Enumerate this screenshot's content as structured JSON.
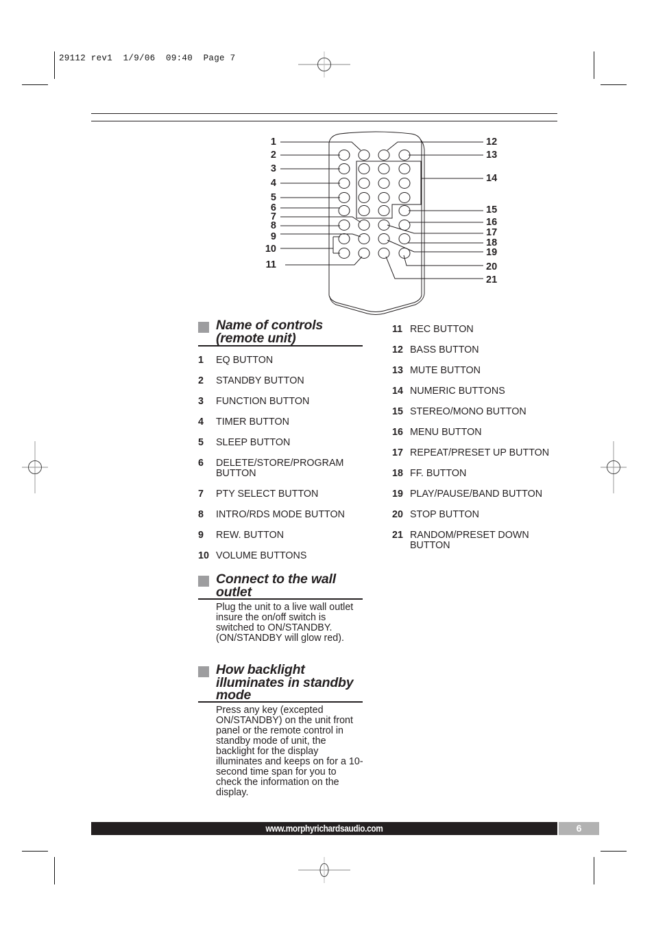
{
  "slug_line": "29112 rev1  1/9/06  09:40  Page 7",
  "diagram": {
    "left_callouts": [
      "1",
      "2",
      "3",
      "4",
      "5",
      "6",
      "7",
      "8",
      "9",
      "10",
      "11"
    ],
    "right_callouts": [
      "12",
      "13",
      "14",
      "15",
      "16",
      "17",
      "18",
      "19",
      "20",
      "21"
    ]
  },
  "sections": {
    "controls": {
      "title": "Name of controls (remote unit)",
      "items": [
        {
          "num": "1",
          "label": "EQ BUTTON"
        },
        {
          "num": "2",
          "label": "STANDBY BUTTON"
        },
        {
          "num": "3",
          "label": "FUNCTION BUTTON"
        },
        {
          "num": "4",
          "label": "TIMER BUTTON"
        },
        {
          "num": "5",
          "label": "SLEEP BUTTON"
        },
        {
          "num": "6",
          "label": "DELETE/STORE/PROGRAM BUTTON"
        },
        {
          "num": "7",
          "label": "PTY SELECT BUTTON"
        },
        {
          "num": "8",
          "label": "INTRO/RDS MODE BUTTON"
        },
        {
          "num": "9",
          "label": "REW. BUTTON"
        },
        {
          "num": "10",
          "label": "VOLUME BUTTONS"
        },
        {
          "num": "11",
          "label": "REC BUTTON"
        },
        {
          "num": "12",
          "label": "BASS BUTTON"
        },
        {
          "num": "13",
          "label": "MUTE BUTTON"
        },
        {
          "num": "14",
          "label": "NUMERIC BUTTONS"
        },
        {
          "num": "15",
          "label": "STEREO/MONO BUTTON"
        },
        {
          "num": "16",
          "label": "MENU BUTTON"
        },
        {
          "num": "17",
          "label": "REPEAT/PRESET UP BUTTON"
        },
        {
          "num": "18",
          "label": "FF. BUTTON"
        },
        {
          "num": "19",
          "label": "PLAY/PAUSE/BAND BUTTON"
        },
        {
          "num": "20",
          "label": "STOP BUTTON"
        },
        {
          "num": "21",
          "label": "RANDOM/PRESET DOWN BUTTON"
        }
      ]
    },
    "wall_outlet": {
      "title": "Connect to the wall outlet",
      "body": "Plug the unit to a live wall outlet insure the on/off switch is switched to ON/STANDBY. (ON/STANDBY will glow red)."
    },
    "backlight": {
      "title": "How backlight illuminates in standby mode",
      "body": "Press any key (excepted ON/STANDBY) on the unit front panel or the remote control in standby mode of unit, the backlight for the display illuminates and keeps on for a 10-second time span for you to check the information on the display."
    }
  },
  "footer": {
    "url": "www.morphyrichardsaudio.com",
    "page_number": "6"
  },
  "colors": {
    "text": "#231f20",
    "section_square": "#9d9d9f",
    "footer_bar": "#231f20",
    "page_box": "#b2b2b2"
  }
}
